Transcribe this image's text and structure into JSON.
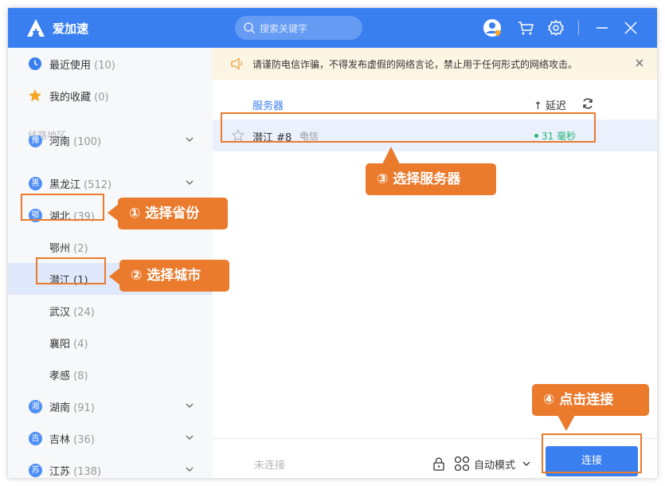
{
  "app": {
    "title": "爱加速",
    "logo_letter": "A"
  },
  "search": {
    "placeholder": "搜索关键字"
  },
  "sidebar": {
    "recent": {
      "label": "最近使用",
      "count": "(10)"
    },
    "favorites": {
      "label": "我的收藏",
      "count": "(0)"
    },
    "section_label": "线路地区",
    "provinces": [
      {
        "badge": "豫",
        "label": "河南",
        "count": "(100)"
      },
      {
        "badge": "黑",
        "label": "黑龙江",
        "count": "(512)"
      },
      {
        "badge": "鄂",
        "label": "湖北",
        "count": "(39)"
      },
      {
        "badge": "湘",
        "label": "湖南",
        "count": "(91)"
      },
      {
        "badge": "吉",
        "label": "吉林",
        "count": "(36)"
      },
      {
        "badge": "苏",
        "label": "江苏",
        "count": "(138)"
      }
    ],
    "cities": [
      {
        "label": "鄂州",
        "count": "(2)"
      },
      {
        "label": "潜江",
        "count": "(1)"
      },
      {
        "label": "武汉",
        "count": "(24)"
      },
      {
        "label": "襄阳",
        "count": "(4)"
      },
      {
        "label": "孝感",
        "count": "(8)"
      }
    ]
  },
  "notice": {
    "text": "请谨防电信诈骗，不得发布虚假的网络言论，禁止用于任何形式的网络攻击。"
  },
  "server_list": {
    "column_header": "服务器",
    "sort_label": "↑ 延迟",
    "rows": [
      {
        "name": "潜江 #8",
        "isp": "电信",
        "latency": "31 毫秒"
      }
    ]
  },
  "bottom": {
    "status": "未连接",
    "mode_label": "自动模式",
    "connect_label": "连接"
  },
  "callouts": {
    "step1": "① 选择省份",
    "step2": "② 选择城市",
    "step3": "③ 选择服务器",
    "step4": "④ 点击连接"
  },
  "colors": {
    "accent": "#3a7ff0",
    "callout": "#ea7a2c",
    "latency_ok": "#2bb673",
    "notice_bg": "#fdf5e3"
  }
}
